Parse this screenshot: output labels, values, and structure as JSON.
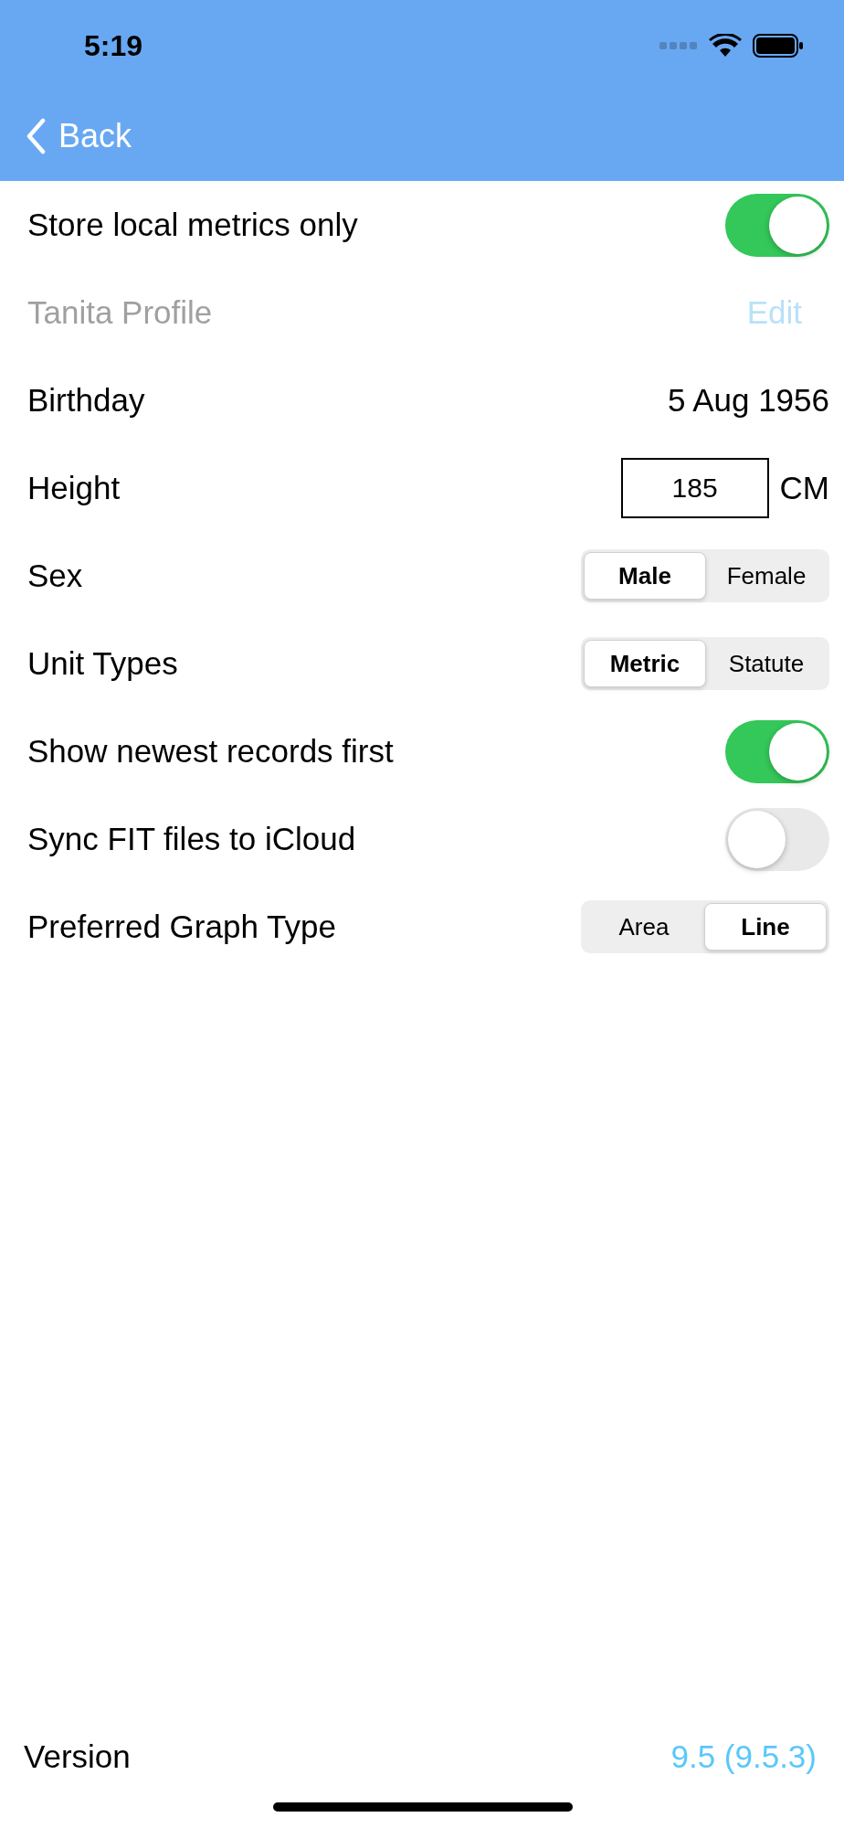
{
  "status_bar": {
    "time": "5:19"
  },
  "nav": {
    "back": "Back"
  },
  "rows": [
    {
      "kind": "toggle",
      "label": "Store local metrics only",
      "on": true
    },
    {
      "kind": "section",
      "label": "Tanita Profile",
      "action": "Edit"
    },
    {
      "kind": "value",
      "label": "Birthday",
      "value": "5 Aug 1956"
    },
    {
      "kind": "input",
      "label": "Height",
      "value": "185",
      "unit": "CM"
    },
    {
      "kind": "segmented",
      "label": "Sex",
      "options": [
        {
          "label": "Male",
          "selected": true
        },
        {
          "label": "Female",
          "selected": false
        }
      ]
    },
    {
      "kind": "segmented",
      "label": "Unit Types",
      "options": [
        {
          "label": "Metric",
          "selected": true
        },
        {
          "label": "Statute",
          "selected": false
        }
      ]
    },
    {
      "kind": "toggle",
      "label": "Show newest records first",
      "on": true
    },
    {
      "kind": "toggle",
      "label": "Sync FIT files to iCloud",
      "on": false
    },
    {
      "kind": "segmented",
      "label": "Preferred Graph Type",
      "options": [
        {
          "label": "Area",
          "selected": false
        },
        {
          "label": "Line",
          "selected": true
        }
      ]
    }
  ],
  "footer": {
    "label": "Version",
    "value": "9.5 (9.5.3)"
  }
}
